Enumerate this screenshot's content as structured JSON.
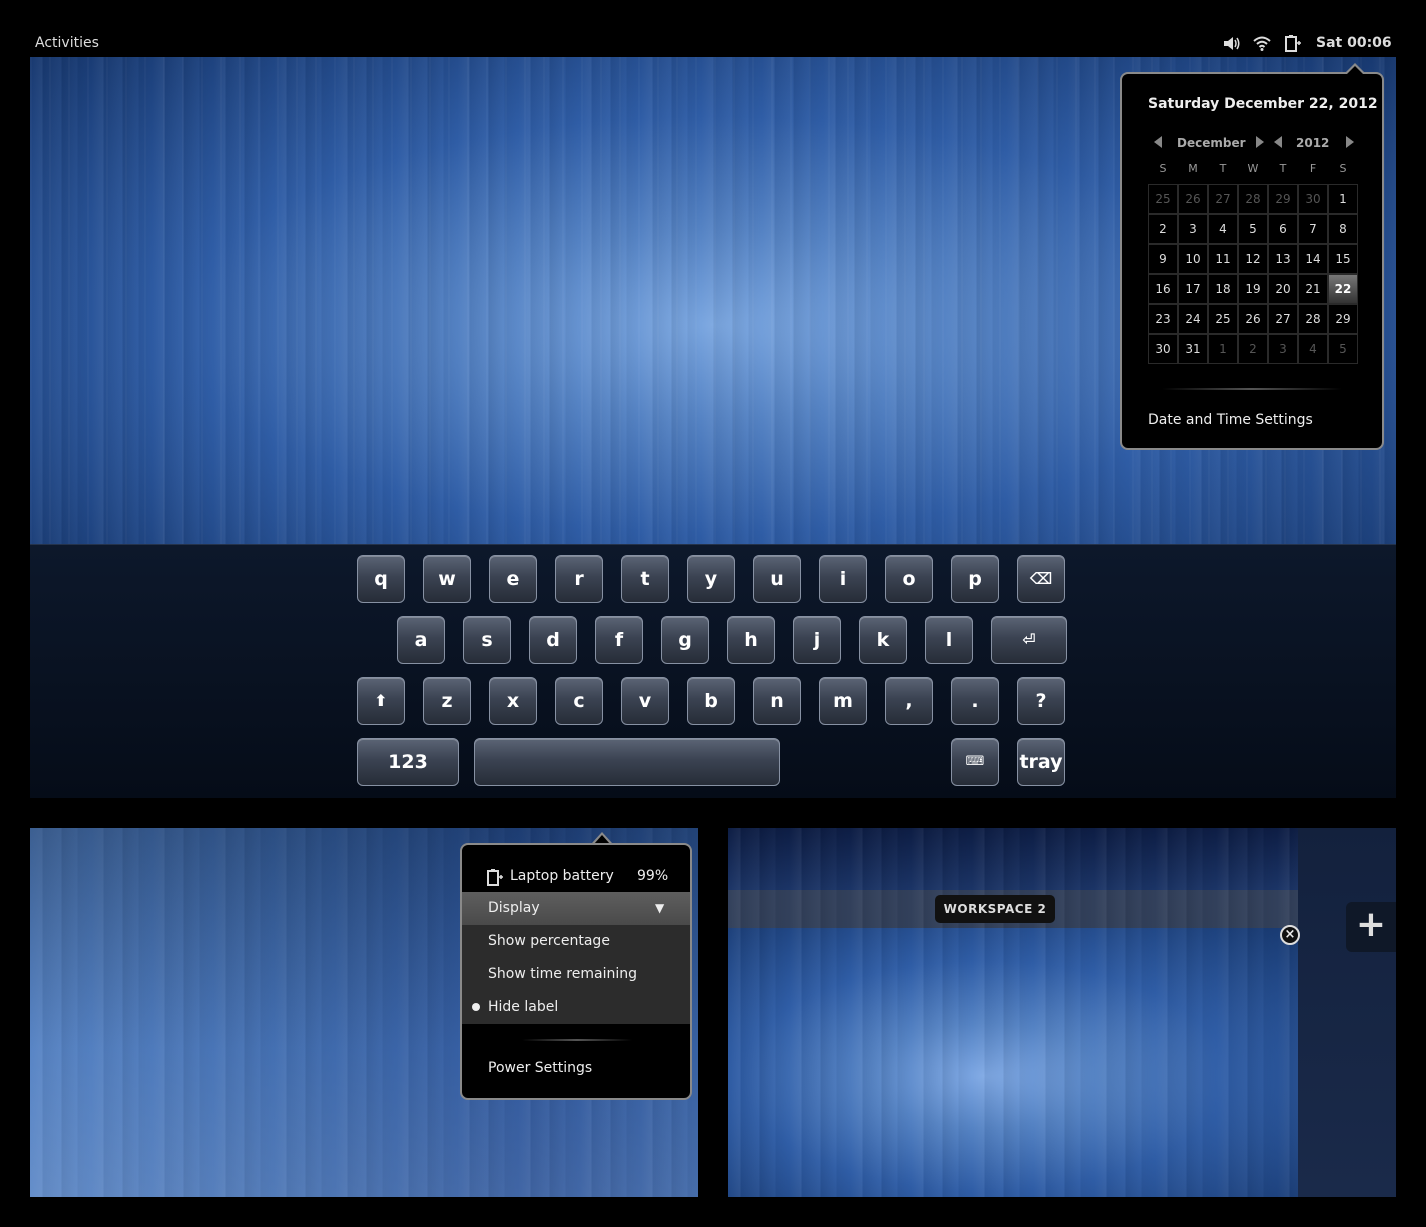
{
  "top_bar": {
    "activities": "Activities",
    "clock": "Sat 00:06",
    "tray_icons": [
      "volume-icon",
      "wifi-icon",
      "battery-icon"
    ]
  },
  "calendar": {
    "title": "Saturday December 22, 2012",
    "month": "December",
    "year": "2012",
    "weekdays": [
      "S",
      "M",
      "T",
      "W",
      "T",
      "F",
      "S"
    ],
    "weeks": [
      [
        "25",
        "26",
        "27",
        "28",
        "29",
        "30",
        "1"
      ],
      [
        "2",
        "3",
        "4",
        "5",
        "6",
        "7",
        "8"
      ],
      [
        "9",
        "10",
        "11",
        "12",
        "13",
        "14",
        "15"
      ],
      [
        "16",
        "17",
        "18",
        "19",
        "20",
        "21",
        "22"
      ],
      [
        "23",
        "24",
        "25",
        "26",
        "27",
        "28",
        "29"
      ],
      [
        "30",
        "31",
        "1",
        "2",
        "3",
        "4",
        "5"
      ]
    ],
    "today": "22",
    "settings_label": "Date and Time Settings"
  },
  "keyboard": {
    "row1": [
      "q",
      "w",
      "e",
      "r",
      "t",
      "y",
      "u",
      "i",
      "o",
      "p",
      "⌫"
    ],
    "row2": [
      "a",
      "s",
      "d",
      "f",
      "g",
      "h",
      "j",
      "k",
      "l",
      "⏎"
    ],
    "row3": [
      "⬆",
      "z",
      "x",
      "c",
      "v",
      "b",
      "n",
      "m",
      ",",
      ".",
      "?"
    ],
    "numbers_key": "123",
    "keyboard_key": "⌨",
    "tray_key": "tray"
  },
  "battery_menu": {
    "device": "Laptop battery",
    "percentage": "99%",
    "display_label": "Display",
    "display_arrow": "▼",
    "options": [
      "Show percentage",
      "Show time remaining",
      "Hide label"
    ],
    "selected_option": "Hide label",
    "settings_label": "Power Settings"
  },
  "workspace": {
    "label": "WORKSPACE 2",
    "close_glyph": "×",
    "add_glyph": "+"
  }
}
